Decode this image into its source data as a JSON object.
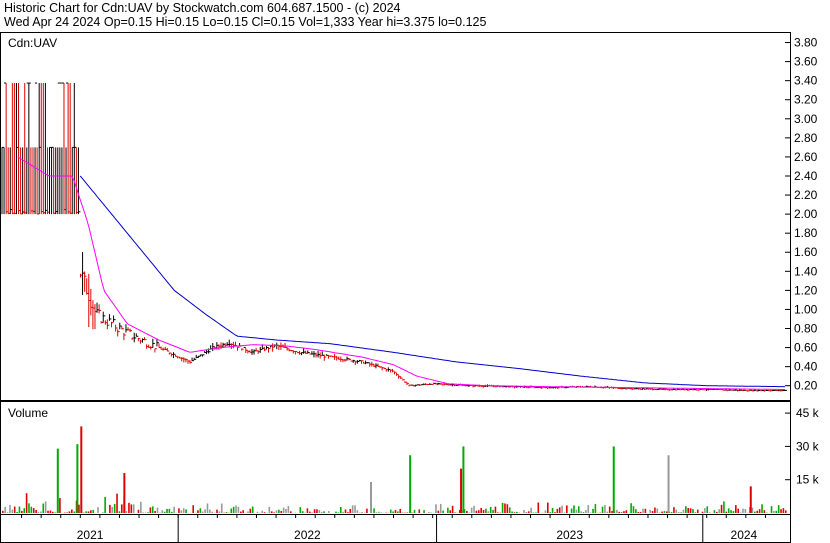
{
  "header": {
    "line1": "Historic Chart for Cdn:UAV by Stockwatch.com 604.687.1500 - (c) 2024",
    "line2": "Wed Apr 24 2024  Op=0.15  Hi=0.15  Lo=0.15  Cl=0.15  Vol=1,333  Year hi=3.375  lo=0.125"
  },
  "chart_data": [
    {
      "type": "line",
      "title": "Cdn:UAV",
      "y_axis_position": "right",
      "ylim": [
        0.05,
        3.9
      ],
      "yticks": [
        "3.80",
        "3.60",
        "3.40",
        "3.20",
        "3.00",
        "2.80",
        "2.60",
        "2.40",
        "2.20",
        "2.00",
        "1.80",
        "1.60",
        "1.40",
        "1.20",
        "1.00",
        "0.80",
        "0.60",
        "0.40",
        "0.20"
      ],
      "grid": false,
      "x_label_periods": [
        "2021",
        "2022",
        "2023",
        "2024"
      ],
      "price_bar_style": "high-low with close tick; black = up, red = down",
      "colors": {
        "short_ma": "#ff00ff",
        "long_ma": "#0000cc",
        "up_bar": "#000000",
        "down_bar": "#e00000"
      },
      "price_keypoints": {
        "comment_free": true,
        "t": [
          0.0,
          0.02,
          0.05,
          0.08,
          0.1,
          0.12,
          0.16,
          0.2,
          0.24,
          0.27,
          0.29,
          0.32,
          0.35,
          0.38,
          0.42,
          0.46,
          0.5,
          0.52,
          0.55,
          0.6,
          0.65,
          0.7,
          0.75,
          0.8,
          0.85,
          0.9,
          0.95,
          1.0
        ],
        "close": [
          2.7,
          2.3,
          2.1,
          2.4,
          1.4,
          0.95,
          0.75,
          0.6,
          0.45,
          0.6,
          0.65,
          0.55,
          0.62,
          0.55,
          0.5,
          0.45,
          0.35,
          0.2,
          0.22,
          0.2,
          0.19,
          0.18,
          0.19,
          0.17,
          0.16,
          0.16,
          0.15,
          0.15
        ]
      },
      "short_ma": {
        "t": [
          0.02,
          0.06,
          0.09,
          0.11,
          0.13,
          0.16,
          0.2,
          0.24,
          0.28,
          0.32,
          0.36,
          0.4,
          0.46,
          0.5,
          0.53,
          0.57,
          0.62,
          0.7,
          0.8,
          0.9,
          1.0
        ],
        "v": [
          2.6,
          2.4,
          2.4,
          1.9,
          1.2,
          0.85,
          0.68,
          0.55,
          0.6,
          0.63,
          0.62,
          0.58,
          0.5,
          0.42,
          0.3,
          0.22,
          0.2,
          0.19,
          0.18,
          0.17,
          0.16
        ]
      },
      "long_ma": {
        "t": [
          0.1,
          0.14,
          0.18,
          0.22,
          0.26,
          0.3,
          0.35,
          0.42,
          0.5,
          0.58,
          0.66,
          0.74,
          0.82,
          0.9,
          1.0
        ],
        "v": [
          2.4,
          2.0,
          1.6,
          1.2,
          0.95,
          0.72,
          0.68,
          0.64,
          0.55,
          0.45,
          0.38,
          0.3,
          0.23,
          0.2,
          0.19
        ]
      }
    },
    {
      "type": "bar",
      "title": "Volume",
      "y_axis_position": "right",
      "ylim": [
        0,
        50000
      ],
      "yticks": [
        "45 k",
        "30 k",
        "15 k"
      ],
      "colors": {
        "up": "#00aa00",
        "down": "#e00000",
        "unchanged": "#999999"
      },
      "spikes": [
        {
          "t": 0.1,
          "value": 39000,
          "dir": "down"
        },
        {
          "t": 0.07,
          "value": 29000,
          "dir": "up"
        },
        {
          "t": 0.095,
          "value": 31000,
          "dir": "up"
        },
        {
          "t": 0.155,
          "value": 18000,
          "dir": "down"
        },
        {
          "t": 0.52,
          "value": 26000,
          "dir": "up"
        },
        {
          "t": 0.588,
          "value": 30000,
          "dir": "up"
        },
        {
          "t": 0.585,
          "value": 20000,
          "dir": "down"
        },
        {
          "t": 0.78,
          "value": 30000,
          "dir": "up"
        },
        {
          "t": 0.85,
          "value": 26000,
          "dir": "unchanged"
        },
        {
          "t": 0.955,
          "value": 12000,
          "dir": "down"
        },
        {
          "t": 0.47,
          "value": 14000,
          "dir": "unchanged"
        }
      ]
    }
  ]
}
